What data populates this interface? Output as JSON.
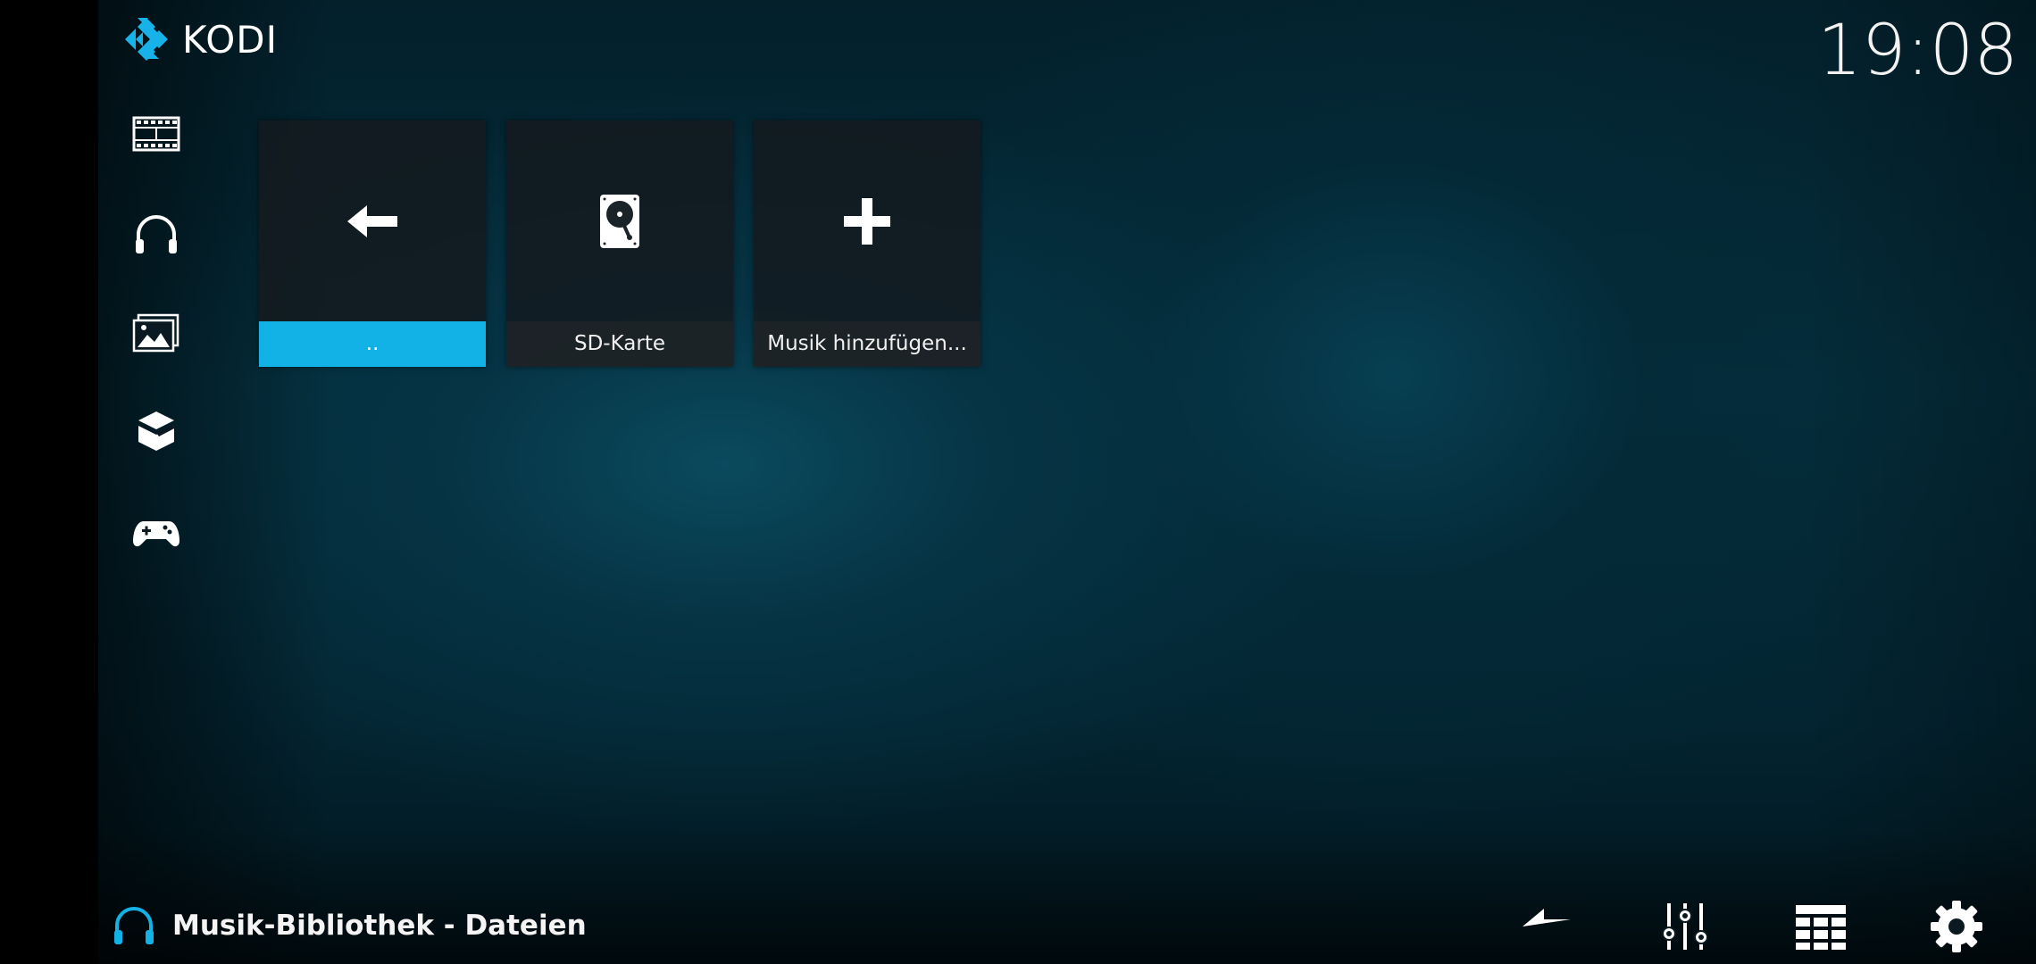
{
  "app": {
    "logo_text": "KODI",
    "clock": "19:08",
    "accent_color": "#12b2e7",
    "logo_color": "#17b2e8"
  },
  "sidebar": {
    "items": [
      {
        "name": "movies",
        "icon": "film-strip-icon"
      },
      {
        "name": "music",
        "icon": "headphones-icon"
      },
      {
        "name": "pictures",
        "icon": "pictures-icon"
      },
      {
        "name": "addons",
        "icon": "addon-box-icon"
      },
      {
        "name": "games",
        "icon": "gamepad-icon"
      }
    ]
  },
  "tiles": [
    {
      "label": "..",
      "icon": "back-arrow-icon",
      "focused": true
    },
    {
      "label": "SD-Karte",
      "icon": "hard-drive-icon",
      "focused": false
    },
    {
      "label": "Musik hinzufügen...",
      "icon": "plus-icon",
      "focused": false
    }
  ],
  "footer": {
    "title": "Musik-Bibliothek - Dateien",
    "title_icon": "headphones-icon",
    "buttons": [
      {
        "name": "back",
        "icon": "back-arrow-icon"
      },
      {
        "name": "options",
        "icon": "sliders-icon"
      },
      {
        "name": "view",
        "icon": "grid-view-icon"
      },
      {
        "name": "settings",
        "icon": "gear-icon"
      }
    ]
  }
}
